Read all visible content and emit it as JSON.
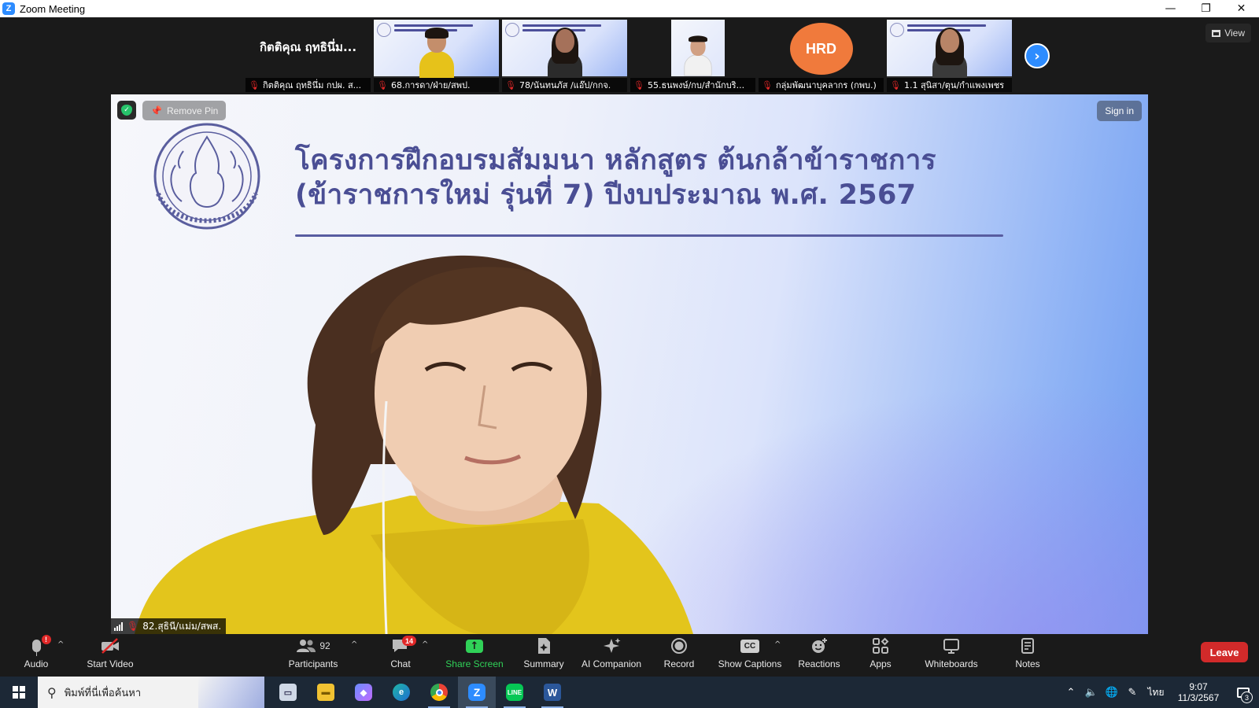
{
  "window": {
    "title": "Zoom Meeting",
    "minimize": "—",
    "restore": "❐",
    "close": "✕"
  },
  "gallery": {
    "featured_name": "กิตติคุณ ฤทธินึ่ม...",
    "tiles": [
      {
        "label": "กิตติคุณ ฤทธินึ่ม กปผ. ส...",
        "type": "name"
      },
      {
        "label": "68.การดา/ฝ่าย/สพป.",
        "type": "slide-person",
        "shirt": "#e6c21a"
      },
      {
        "label": "78/นันทนภัส /แอ๊ป/กกจ.",
        "type": "slide-person",
        "shirt": "#2b2b2b"
      },
      {
        "label": "55.ธนพงษ์/กบ/สำนักบริ...",
        "type": "narrow-person",
        "shirt": "#f1f1f1"
      },
      {
        "label": "กลุ่มพัฒนาบุคลากร (กพบ.)",
        "type": "logo",
        "logo_text": "HRD"
      },
      {
        "label": "1.1 สุนิสา/ตุน/กำแพงเพชร",
        "type": "slide-person",
        "shirt": "#3a3a3a"
      }
    ],
    "next_icon": "›",
    "view_label": "View"
  },
  "main_video": {
    "remove_pin": "Remove Pin",
    "sign_in": "Sign in",
    "slide_title_line1": "โครงการฝึกอบรมสัมมนา หลักสูตร ต้นกล้าข้าราชการ",
    "slide_title_line2": "(ข้าราชการใหม่ รุ่นที่ 7) ปีงบประมาณ พ.ศ. 2567",
    "speaker_name": "82.สุธินี/แม่ม/สพส."
  },
  "toolbar": {
    "audio": "Audio",
    "audio_alert": "!",
    "start_video": "Start Video",
    "participants": "Participants",
    "participants_count": "92",
    "chat": "Chat",
    "chat_badge": "14",
    "share_screen": "Share Screen",
    "summary": "Summary",
    "ai_companion": "AI Companion",
    "record": "Record",
    "show_captions": "Show Captions",
    "captions_icon": "CC",
    "reactions": "Reactions",
    "apps": "Apps",
    "whiteboards": "Whiteboards",
    "notes": "Notes",
    "leave": "Leave"
  },
  "taskbar": {
    "search_placeholder": "พิมพ์ที่นี่เพื่อค้นหา",
    "language": "ไทย",
    "time": "9:07",
    "date": "11/3/2567",
    "notification_count": "3"
  },
  "colors": {
    "zoom_blue": "#2d8cff",
    "leave_red": "#d22a2a",
    "share_green": "#30d158",
    "slide_text": "#4a4e94"
  }
}
